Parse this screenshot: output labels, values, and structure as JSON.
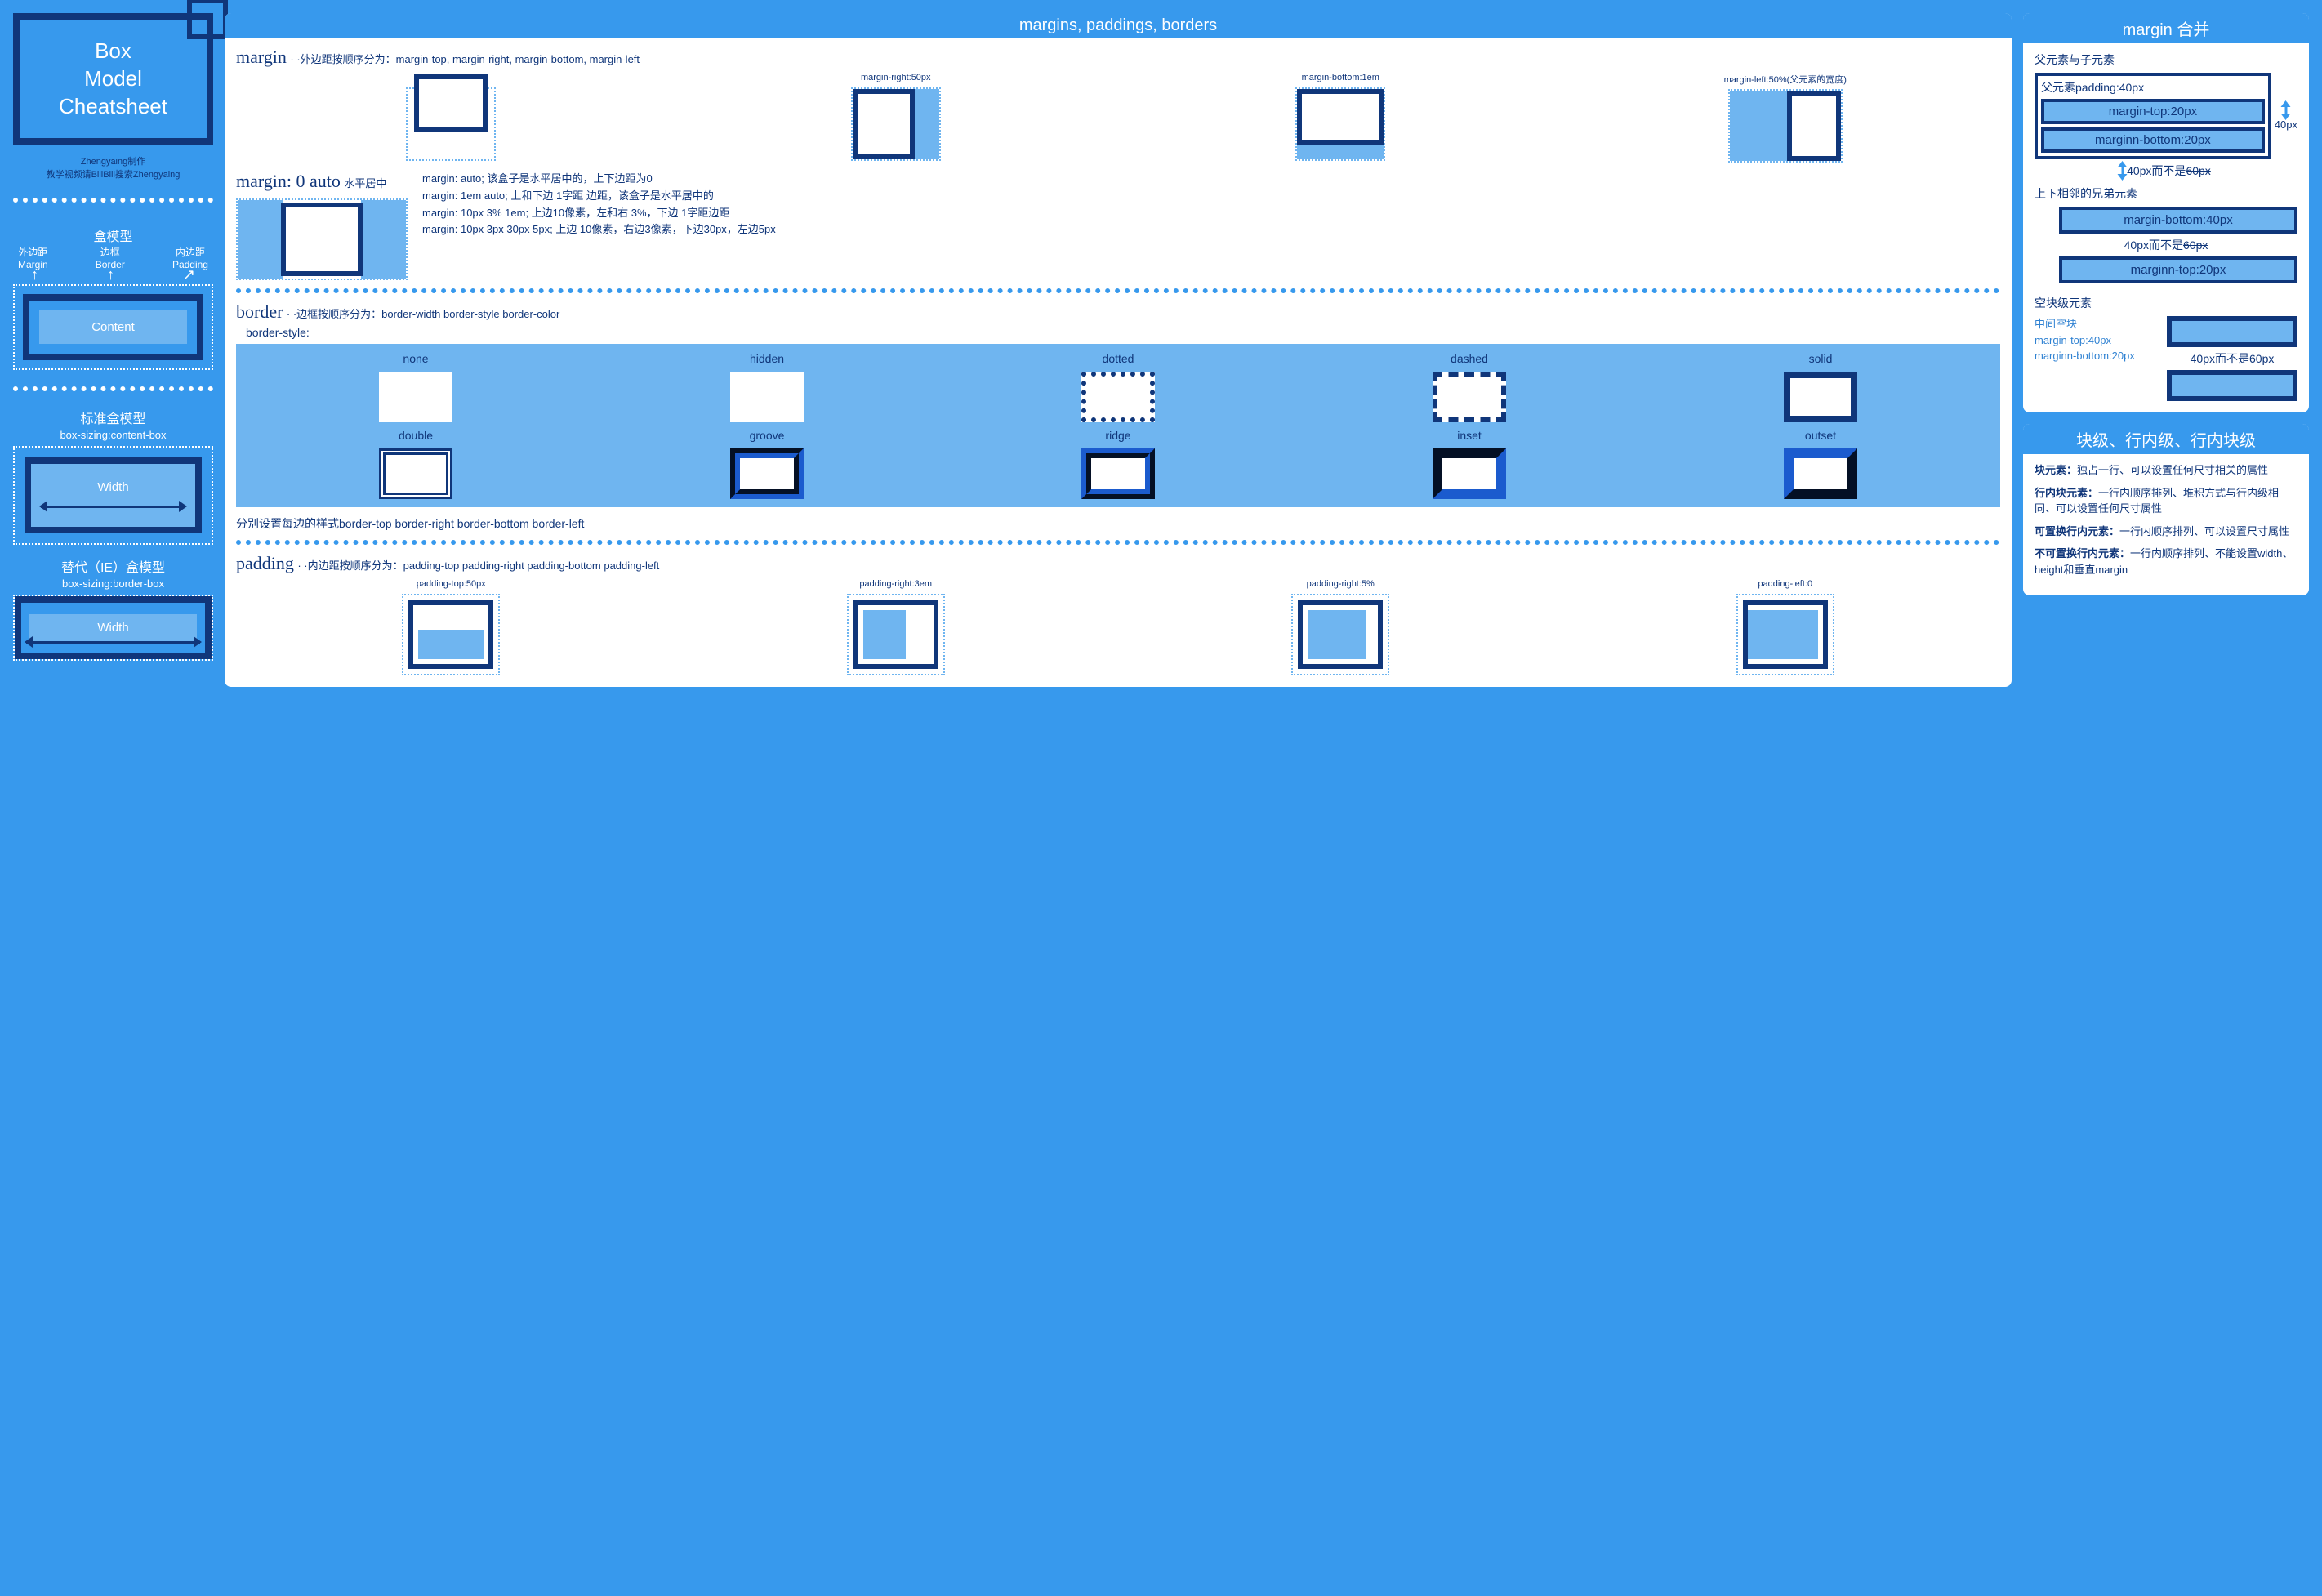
{
  "left": {
    "title_line1": "Box",
    "title_line2": "Model",
    "title_line3": "Cheatsheet",
    "credit_line1": "Zhengyaing制作",
    "credit_line2": "教学视频请BiliBili搜索Zhengyaing",
    "labels": {
      "boxmodel_heading": "盒模型",
      "margin_cn": "外边距",
      "margin_en": "Margin",
      "border_cn": "边框",
      "border_en": "Border",
      "padding_cn": "内边距",
      "padding_en": "Padding",
      "content": "Content"
    },
    "std_heading": "标准盒模型",
    "std_sub": "box-sizing:content-box",
    "std_width": "Width",
    "alt_heading": "替代（IE）盒模型",
    "alt_sub": "box-sizing:border-box",
    "alt_width": "Width"
  },
  "mid": {
    "header": "margins, paddings, borders",
    "margin": {
      "title": "margin",
      "desc": "· ·外边距按顺序分为：margin-top, margin-right, margin-bottom, margin-left",
      "ex": [
        "margin-top:-50px",
        "margin-right:50px",
        "margin-bottom:1em",
        "margin-left:50%(父元素的宽度)"
      ]
    },
    "auto": {
      "title": "margin: 0 auto",
      "sub": "水平居中",
      "lines": [
        "margin: auto; 该盒子是水平居中的，上下边距为0",
        "margin: 1em auto; 上和下边 1字距 边距，该盒子是水平居中的",
        "margin: 10px 3% 1em; 上边10像素，左和右 3%，下边 1字距边距",
        "margin: 10px 3px 30px 5px; 上边 10像素，右边3像素，下边30px，左边5px"
      ]
    },
    "border": {
      "title": "border",
      "desc": "· ·边框按顺序分为：border-width border-style border-color",
      "style_label": "border-style:",
      "styles": [
        "none",
        "hidden",
        "dotted",
        "dashed",
        "solid",
        "double",
        "groove",
        "ridge",
        "inset",
        "outset"
      ],
      "each": "分别设置每边的样式border-top border-right border-bottom border-left"
    },
    "padding": {
      "title": "padding",
      "desc": "· ·内边距按顺序分为：padding-top padding-right padding-bottom padding-left",
      "ex": [
        "padding-top:50px",
        "padding-right:3em",
        "padding-right:5%",
        "padding-left:0"
      ]
    }
  },
  "right": {
    "collapse": {
      "header": "margin 合并",
      "parent_child": "父元素与子元素",
      "pc_parent": "父元素padding:40px",
      "pc_measure": "40px",
      "pc_c1": "margin-top:20px",
      "pc_c2": "marginn-bottom:20px",
      "pc_result": "40px而不是",
      "pc_strike": "60px",
      "siblings": "上下相邻的兄弟元素",
      "sib_top": "margin-bottom:40px",
      "sib_bot": "marginn-top:20px",
      "sib_result": "40px而不是",
      "sib_strike": "60px",
      "empty": "空块级元素",
      "empty_label": "中间空块",
      "empty_mt": "margin-top:40px",
      "empty_mb": "marginn-bottom:20px",
      "empty_result": "40px而不是",
      "empty_strike": "60px"
    },
    "display": {
      "header": "块级、行内级、行内块级",
      "block_t": "块元素：",
      "block_d": "独占一行、可以设置任何尺寸相关的属性",
      "ib_t": "行内块元素：",
      "ib_d": "一行内顺序排列、堆积方式与行内级相同、可以设置任何尺寸属性",
      "rep_t": "可置换行内元素：",
      "rep_d": "一行内顺序排列、可以设置尺寸属性",
      "inl_t": "不可置换行内元素：",
      "inl_d": "一行内顺序排列、不能设置width、height和垂直margin"
    }
  }
}
